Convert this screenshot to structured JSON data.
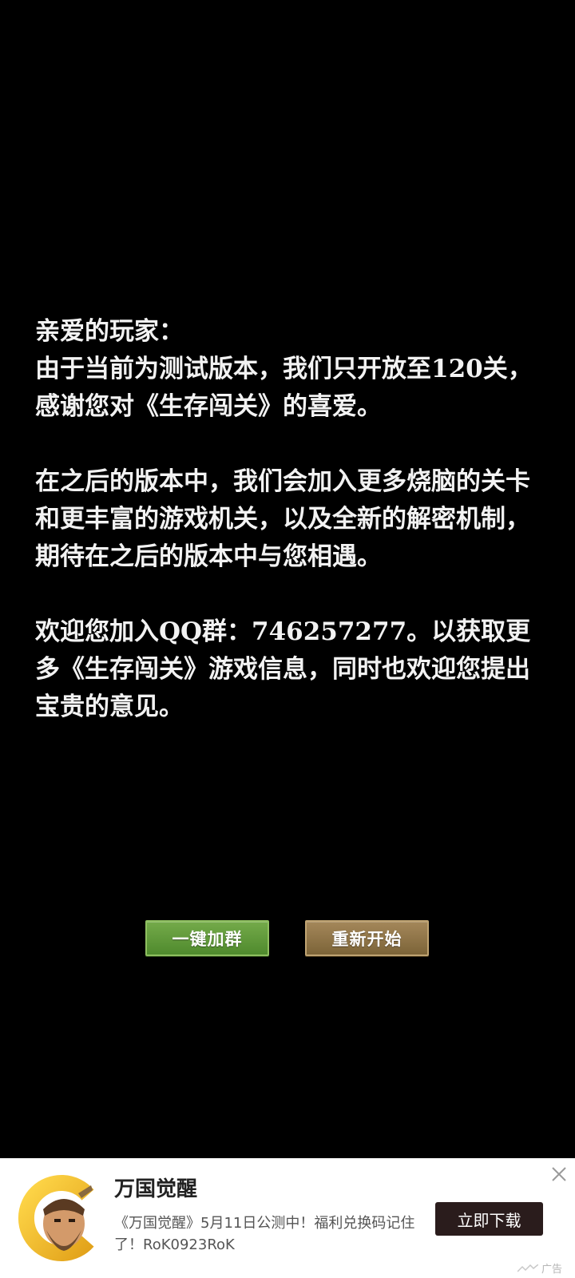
{
  "notice": {
    "greeting": "亲爱的玩家：",
    "paragraph1": "由于当前为测试版本，我们只开放至120关，感谢您对《生存闯关》的喜爱。",
    "paragraph2": "在之后的版本中，我们会加入更多烧脑的关卡和更丰富的游戏机关，以及全新的解密机制，期待在之后的版本中与您相遇。",
    "paragraph3": "欢迎您加入QQ群：746257277。以获取更多《生存闯关》游戏信息，同时也欢迎您提出宝贵的意见。"
  },
  "buttons": {
    "join_group": "一键加群",
    "restart": "重新开始"
  },
  "ad": {
    "title": "万国觉醒",
    "description": "《万国觉醒》5月11日公测中！福利兑换码记住了！RoK0923RoK",
    "cta": "立即下载",
    "tag": "广告",
    "icon": "game-app-icon"
  },
  "colors": {
    "background": "#000000",
    "text": "#f2f2f2",
    "join_button": "#5f9a3a",
    "restart_button": "#8c7346",
    "ad_cta": "#2a1c1c"
  }
}
